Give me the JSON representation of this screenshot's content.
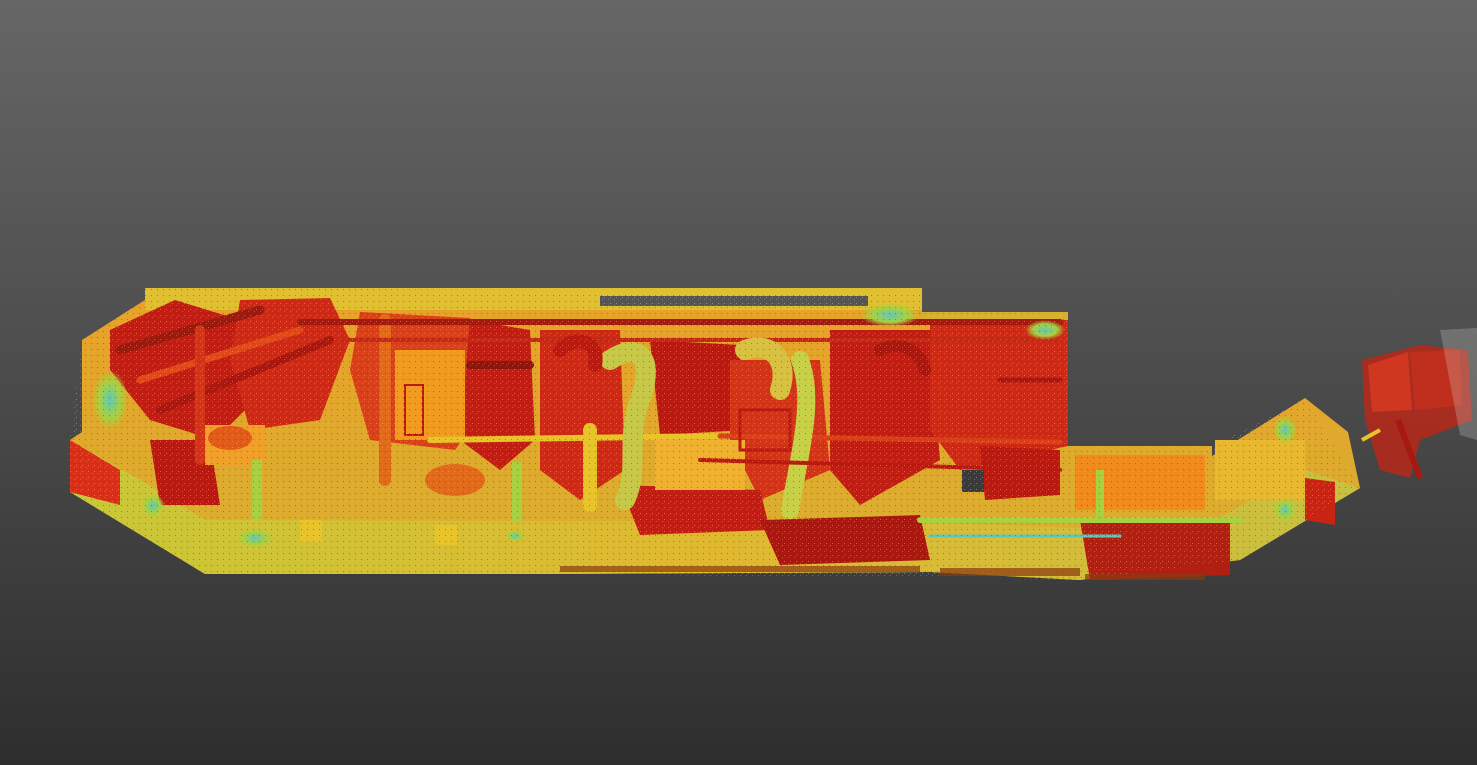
{
  "viewer": {
    "background_top": "#666666",
    "background_bottom": "#2e2e2e"
  },
  "point_cloud": {
    "subject": "ship-engine-room-scan",
    "colormap": "intensity",
    "palette": {
      "low": "#b81a10",
      "mid_low": "#e0461a",
      "mid": "#f08a1c",
      "mid_high": "#e8c42a",
      "high": "#a8d040",
      "peak": "#5ec8b8"
    }
  }
}
